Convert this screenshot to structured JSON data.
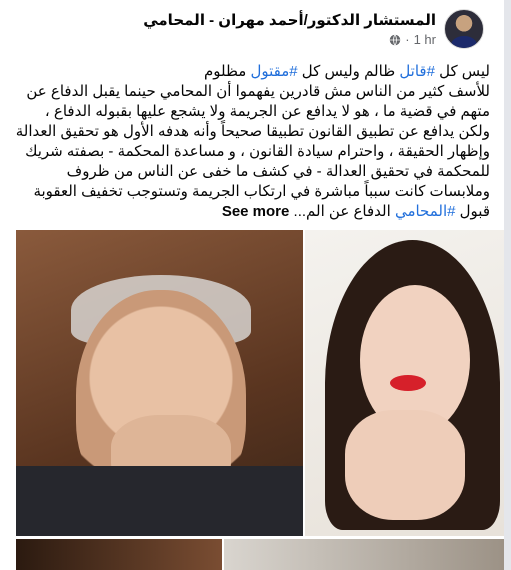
{
  "post": {
    "author": "المستشار الدكتور/أحمد مهران - المحامي",
    "time": "1 hr",
    "separator": "·",
    "audience_icon": "globe-icon",
    "text": {
      "p1_pre": "ليس كل ",
      "tag1": "#قاتل",
      "p1_mid": " ظالم وليس كل ",
      "tag2": "#مقتول",
      "p1_post": " مظلوم",
      "p2": "للأسف كثير من الناس مش قادرين يفهموا أن المحامي حينما يقبل الدفاع عن متهم في قضية ما ، هو لا يدافع عن الجريمة ولا يشجع عليها بقبوله الدفاع ، ولكن يدافع عن تطبيق القانون تطبيقا صحيحاً وأنه هدفه الأول هو تحقيق العدالة وإظهار الحقيقة ، واحترام سيادة القانون ، و مساعدة المحكمة - بصفته شريك للمحكمة في تحقيق العدالة - في كشف ما خفى عن الناس من ظروف وملابسات كانت سبباً مباشرة في ارتكاب الجريمة وتستوجب تخفيف العقوبة قبول ",
      "tag3": "#المحامي",
      "p2_post": " الدفاع عن الم...",
      "see_more": "See more"
    }
  },
  "colors": {
    "hashtag": "#216fdb",
    "page_bg": "#f0f2f5"
  }
}
